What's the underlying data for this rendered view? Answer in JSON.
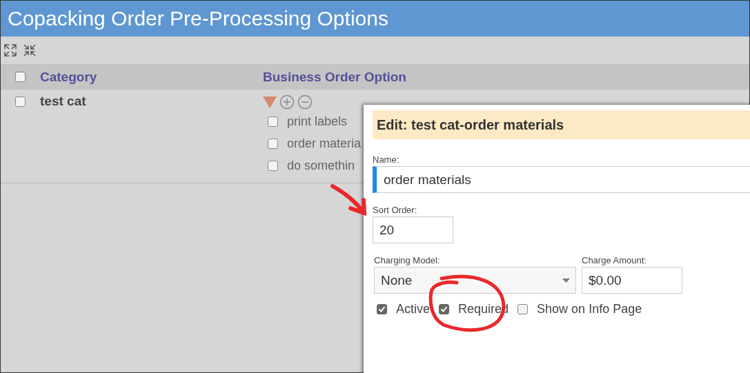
{
  "window": {
    "title": "Copacking Order Pre-Processing Options"
  },
  "table": {
    "all_checked": false,
    "columns": [
      "Category",
      "Business Order Option"
    ],
    "rows": [
      {
        "category": "test cat",
        "checked": false,
        "expanded": true,
        "options": [
          {
            "label": "print labels",
            "checked": false
          },
          {
            "label": "order materia",
            "checked": false
          },
          {
            "label": "do somethin",
            "checked": false
          }
        ]
      }
    ]
  },
  "dialog": {
    "title": "Edit: test cat-order materials",
    "name": {
      "label": "Name:",
      "value": "order materials"
    },
    "sort_order": {
      "label": "Sort Order:",
      "value": "20"
    },
    "charging_model": {
      "label": "Charging Model:",
      "value": "None"
    },
    "charge_amount": {
      "label": "Charge Amount:",
      "value": "$0.00"
    },
    "checkboxes": [
      {
        "label": "Active",
        "checked": true
      },
      {
        "label": "Required",
        "checked": true
      },
      {
        "label": "Show on Info Page",
        "checked": false
      }
    ]
  }
}
